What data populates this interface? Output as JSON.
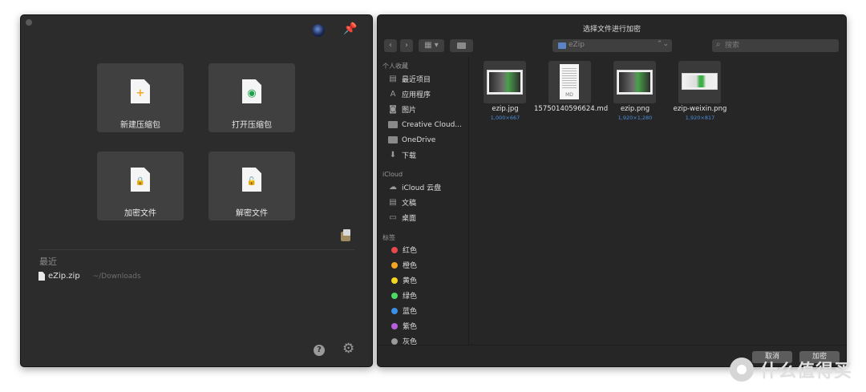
{
  "left_window": {
    "tiles": [
      {
        "label": "新建压缩包",
        "glyph": "+",
        "icon": "new-archive-icon"
      },
      {
        "label": "打开压缩包",
        "glyph": "◉",
        "icon": "open-archive-icon"
      },
      {
        "label": "加密文件",
        "glyph": "🔒",
        "icon": "encrypt-file-icon"
      },
      {
        "label": "解密文件",
        "glyph": "🔓",
        "icon": "decrypt-file-icon"
      }
    ],
    "pin_glyph": "📌",
    "recent": {
      "title": "最近",
      "items": [
        {
          "name": "eZip.zip",
          "path": "~/Downloads"
        }
      ]
    },
    "help_glyph": "?",
    "gear_glyph": "⚙"
  },
  "dialog": {
    "title": "选择文件进行加密",
    "toolbar": {
      "back_glyph": "‹",
      "forward_glyph": "›",
      "view_glyph": "▦ ▾",
      "path_value": "eZip",
      "path_arrows": "⌃⌄",
      "search_placeholder": "搜索",
      "search_glyph": "⌕"
    },
    "sidebar": {
      "favorites_header": "个人收藏",
      "favorites": [
        {
          "label": "最近项目",
          "icon": "recents-icon",
          "glyph": "▤"
        },
        {
          "label": "应用程序",
          "icon": "applications-icon",
          "glyph": "A"
        },
        {
          "label": "图片",
          "icon": "pictures-icon",
          "glyph": "◙"
        },
        {
          "label": "Creative Cloud...",
          "icon": "folder-icon",
          "glyph": ""
        },
        {
          "label": "OneDrive",
          "icon": "folder-icon",
          "glyph": ""
        },
        {
          "label": "下载",
          "icon": "downloads-icon",
          "glyph": "⬇"
        }
      ],
      "icloud_header": "iCloud",
      "icloud": [
        {
          "label": "iCloud 云盘",
          "icon": "cloud-icon",
          "glyph": "☁"
        },
        {
          "label": "文稿",
          "icon": "documents-icon",
          "glyph": "▤"
        },
        {
          "label": "桌面",
          "icon": "desktop-icon",
          "glyph": "▭"
        }
      ],
      "tags_header": "标签",
      "tags": [
        {
          "label": "红色",
          "color": "#e5484d"
        },
        {
          "label": "橙色",
          "color": "#f5a623"
        },
        {
          "label": "黄色",
          "color": "#f5d623"
        },
        {
          "label": "绿色",
          "color": "#4cd964"
        },
        {
          "label": "蓝色",
          "color": "#3b8fe6"
        },
        {
          "label": "紫色",
          "color": "#b660e0"
        },
        {
          "label": "灰色",
          "color": "#9a9a9a"
        }
      ]
    },
    "files": [
      {
        "name": "ezip.jpg",
        "dims": "1,000×667",
        "kind": "image"
      },
      {
        "name": "15750140596624.md",
        "dims": "",
        "kind": "markdown",
        "thumb_tag": "MD"
      },
      {
        "name": "ezip.png",
        "dims": "1,920×1,280",
        "kind": "image"
      },
      {
        "name": "ezip-weixin.png",
        "dims": "1,920×817",
        "kind": "image-wide"
      }
    ],
    "buttons": {
      "cancel": "取消",
      "confirm": "加密"
    }
  },
  "watermark": {
    "text": "什么值得买"
  }
}
